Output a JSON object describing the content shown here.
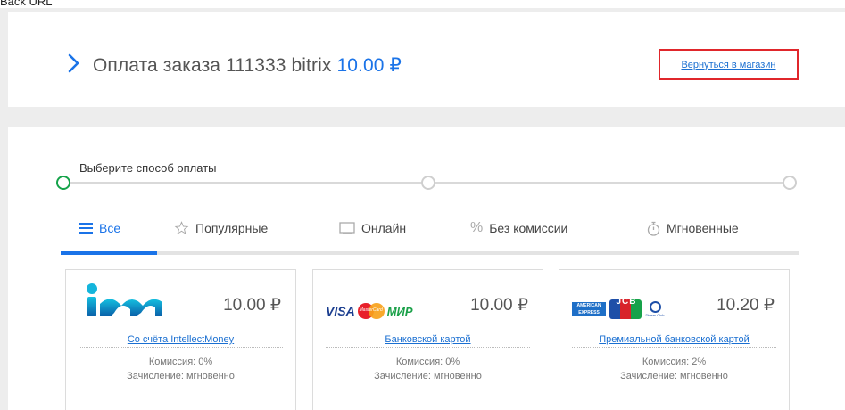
{
  "top_caption": "Back URL",
  "header": {
    "title": "Оплата заказа 111333 bitrix",
    "amount": "10.00 ₽",
    "back_link": "Вернуться в магазин"
  },
  "stepper": {
    "label": "Выберите способ оплаты"
  },
  "tabs": [
    {
      "label": "Все",
      "icon": "menu-icon",
      "active": true
    },
    {
      "label": "Популярные",
      "icon": "star-icon",
      "active": false
    },
    {
      "label": "Онлайн",
      "icon": "monitor-icon",
      "active": false
    },
    {
      "label": "Без комиссии",
      "icon": "percent-icon",
      "active": false
    },
    {
      "label": "Мгновенные",
      "icon": "stopwatch-icon",
      "active": false
    }
  ],
  "payment_methods": [
    {
      "logo": "IntellectMoney",
      "amount": "10.00 ₽",
      "name": "Со счёта IntellectMoney",
      "commission": "Комиссия: 0%",
      "crediting": "Зачисление: мгновенно"
    },
    {
      "logo": "VISA / MasterCard / МИР",
      "logo_visa": "VISA",
      "logo_mc": "MasterCard",
      "logo_mir": "МИР",
      "amount": "10.00 ₽",
      "name": "Банковской картой",
      "commission": "Комиссия: 0%",
      "crediting": "Зачисление: мгновенно"
    },
    {
      "logo": "American Express / JCB / Diners Club",
      "logo_amex": "AMERICAN EXPRESS",
      "logo_jcb": "JCB",
      "logo_diners": "Diners Club",
      "amount": "10.20 ₽",
      "name": "Премиальной банковской картой",
      "commission": "Комиссия: 2%",
      "crediting": "Зачисление: мгновенно"
    }
  ],
  "colors": {
    "accent": "#1a73e8",
    "highlight_border": "#e0262b",
    "step_active": "#15a34a"
  }
}
